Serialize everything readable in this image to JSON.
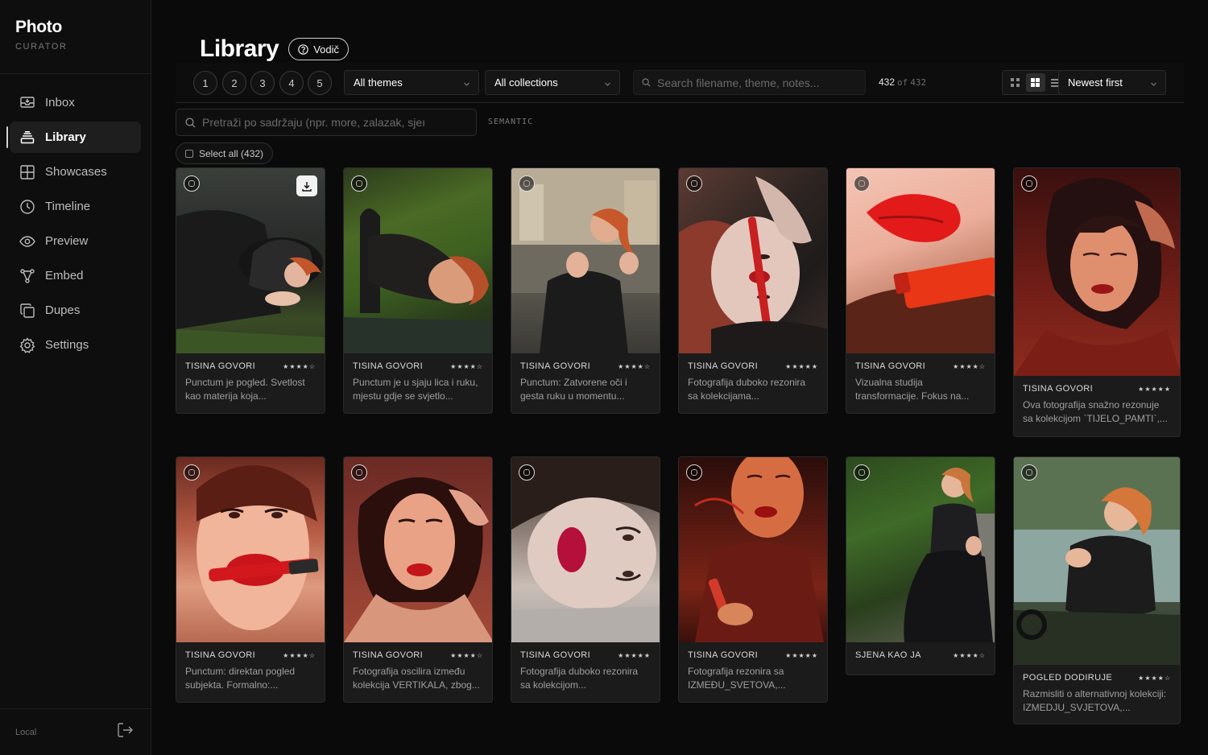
{
  "brand": {
    "name": "Photo",
    "subtitle": "CURATOR"
  },
  "nav": [
    {
      "label": "Inbox",
      "icon": "inbox-icon",
      "active": false
    },
    {
      "label": "Library",
      "icon": "library-icon",
      "active": true
    },
    {
      "label": "Showcases",
      "icon": "showcases-icon",
      "active": false
    },
    {
      "label": "Timeline",
      "icon": "clock-icon",
      "active": false
    },
    {
      "label": "Preview",
      "icon": "eye-icon",
      "active": false
    },
    {
      "label": "Embed",
      "icon": "embed-icon",
      "active": false
    },
    {
      "label": "Dupes",
      "icon": "duplicate-icon",
      "active": false
    },
    {
      "label": "Settings",
      "icon": "gear-icon",
      "active": false
    }
  ],
  "footer": {
    "mode": "Local",
    "logout_icon": "logout-icon"
  },
  "page": {
    "title": "Library",
    "guide_label": "Vodič"
  },
  "toolbar": {
    "pages": [
      "1",
      "2",
      "3",
      "4",
      "5"
    ],
    "theme_filter": "All themes",
    "collection_filter": "All collections",
    "search_placeholder": "Search filename, theme, notes...",
    "shown_count": "432",
    "of_label": "of",
    "total_count": "432",
    "sort": "Newest first",
    "view_modes": [
      "grid-small-icon",
      "grid-large-icon",
      "list-icon"
    ],
    "active_view": 1
  },
  "semantic": {
    "placeholder": "Pretraži po sadržaju (npr. more, zalazak, sjeı",
    "tag": "SEMANTIC"
  },
  "select_all_label": "Select all (432)",
  "colors": {
    "background": "#0a0a0a",
    "card": "#1b1b1b",
    "text": "#e6e6e6",
    "muted": "#9f9f9f"
  },
  "photos": [
    {
      "theme": "TISINA GOVORI",
      "stars": "★★★★☆",
      "rating": 4,
      "desc": "Punctum je pogled. Svetlost kao materija koja...",
      "download": true
    },
    {
      "theme": "TISINA GOVORI",
      "stars": "★★★★☆",
      "rating": 4,
      "desc": "Punctum je u sjaju lica i ruku, mjestu gdje se svjetlo...",
      "download": false
    },
    {
      "theme": "TISINA GOVORI",
      "stars": "★★★★☆",
      "rating": 4,
      "desc": "Punctum: Zatvorene oči i gesta ruku u momentu...",
      "download": false
    },
    {
      "theme": "TISINA GOVORI",
      "stars": "★★★★★",
      "rating": 5,
      "desc": "Fotografija duboko rezonira sa kolekcijama...",
      "download": false
    },
    {
      "theme": "TISINA GOVORI",
      "stars": "★★★★☆",
      "rating": 4,
      "desc": "Vizualna studija transformacije. Fokus na...",
      "download": false
    },
    {
      "theme": "TISINA GOVORI",
      "stars": "★★★★★",
      "rating": 5,
      "desc": "Ova fotografija snažno rezonuje sa kolekcijom `TIJELO_PAMTI`,...",
      "download": false
    },
    {
      "theme": "TISINA GOVORI",
      "stars": "★★★★☆",
      "rating": 4,
      "desc": "Punctum: direktan pogled subjekta. Formalno:...",
      "download": false
    },
    {
      "theme": "TISINA GOVORI",
      "stars": "★★★★☆",
      "rating": 4,
      "desc": "Fotografija oscilira između kolekcija VERTIKALA, zbog...",
      "download": false
    },
    {
      "theme": "TISINA GOVORI",
      "stars": "★★★★★",
      "rating": 5,
      "desc": "Fotografija duboko rezonira sa kolekcijom...",
      "download": false
    },
    {
      "theme": "TISINA GOVORI",
      "stars": "★★★★★",
      "rating": 5,
      "desc": "Fotografija rezonira sa IZMEĐU_SVETOVA,...",
      "download": false
    },
    {
      "theme": "SJENA KAO JA",
      "stars": "★★★★☆",
      "rating": 4,
      "desc": "",
      "download": false
    },
    {
      "theme": "POGLED DODIRUJE",
      "stars": "★★★★☆",
      "rating": 4,
      "desc": "Razmisliti o alternativnoj kolekciji: IZMEDJU_SVJETOVA,...",
      "download": false
    }
  ]
}
